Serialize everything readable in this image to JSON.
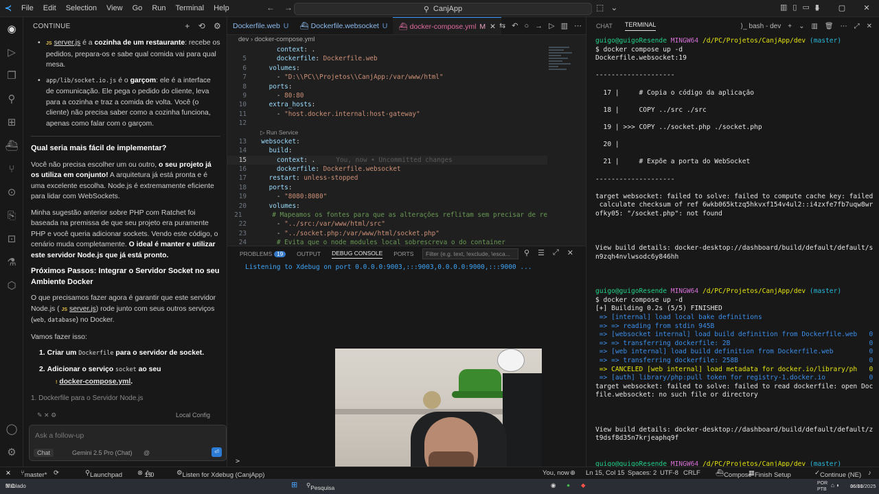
{
  "titlebar": {
    "menu": [
      "File",
      "Edit",
      "Selection",
      "View",
      "Go",
      "Run",
      "Terminal",
      "Help"
    ],
    "search_text": "CanjApp"
  },
  "sidepanel": {
    "header": "CONTINUE",
    "chat": {
      "b1_file": "server.js",
      "b1_js": "JS",
      "b1_mid": " é a ",
      "b1_bold": "cozinha de um restaurante",
      "b1_rest": ": recebe os pedidos, prepara-os e sabe qual comida vai para qual mesa.",
      "b2_code": "app/lib/socket.io.js",
      "b2_mid": " é o ",
      "b2_bold": "garçom",
      "b2_rest": ": ele é a interface de comunicação. Ele pega o pedido do cliente, leva para a cozinha e traz a comida de volta. Você (o cliente) não precisa saber como a cozinha funciona, apenas como falar com o garçom.",
      "h1": "Qual seria mais fácil de implementar?",
      "p1_a": "Você não precisa escolher um ou outro, ",
      "p1_bold": "o seu projeto já os utiliza em conjunto!",
      "p1_b": " A arquitetura já está pronta e é uma excelente escolha. Node.js é extremamente eficiente para lidar com WebSockets.",
      "p2_a": "Minha sugestão anterior sobre PHP com Ratchet foi baseada na premissa de que seu projeto era puramente PHP e você queria adicionar sockets. Vendo este código, o cenário muda completamente. ",
      "p2_bold": "O ideal é manter e utilizar este servidor Node.js que já está pronto.",
      "h2": "Próximos Passos: Integrar o Servidor Socket no seu Ambiente Docker",
      "p3_a": "O que precisamos fazer agora é garantir que este servidor Node.js (",
      "p3_js": "JS",
      "p3_file": "server.js",
      "p3_b": ") rode junto com seus outros serviços (",
      "p3_code1": "web",
      "p3_sep": ", ",
      "p3_code2": "database",
      "p3_c": ") no Docker.",
      "p4": "Vamos fazer isso:",
      "s1_num": "1.",
      "s1_a": "Criar um ",
      "s1_code": "Dockerfile",
      "s1_b": " para o servidor de socket.",
      "s2_num": "2.",
      "s2_a": "Adicionar o serviço ",
      "s2_code": "socket",
      "s2_b": " ao seu",
      "s2_file": "docker-compose.yml",
      "s2_end": ".",
      "s3_ghost": "1. Dockerfile para o Servidor Node.js"
    },
    "local_config": "Local Config",
    "input_placeholder": "Ask a follow-up",
    "chip": "Chat",
    "model": "Gemini 2.5 Pro (Chat)",
    "at": "@"
  },
  "editor": {
    "tabs": [
      {
        "label": "Dockerfile.web",
        "suffix": "U"
      },
      {
        "label": "Dockerfile.websocket",
        "suffix": "U"
      },
      {
        "label": "docker-compose.yml",
        "suffix": "M"
      }
    ],
    "breadcrumb": "dev  ›  docker-compose.yml",
    "codelens": "Run Service",
    "blame": "You, now • Uncommitted changes"
  },
  "panel": {
    "tabs": [
      "PROBLEMS",
      "OUTPUT",
      "DEBUG CONSOLE",
      "PORTS"
    ],
    "problems_count": "19",
    "filter_placeholder": "Filter (e.g. text, !exclude, \\esca...",
    "output_line": "Listening to Xdebug on port 0.0.0.0:9003,:::9003,0.0.0.0:9000,:::9000 ...",
    "prompt": ">"
  },
  "terminal": {
    "tab_chat": "CHAT",
    "tab_terminal": "TERMINAL",
    "shell": "bash - dev"
  },
  "status": {
    "branch": "master*",
    "launch": "Launchpad",
    "errors": "19",
    "warnings": "0",
    "xdebug": "Listen for Xdebug (CanjApp)",
    "blame": "You, now",
    "pos": "Ln 15, Col 15",
    "spaces": "Spaces: 2",
    "enc": "UTF-8",
    "eol": "CRLF",
    "compose": "Compose",
    "finish": "Finish Setup",
    "cont": "Continue (NE)"
  },
  "taskbar": {
    "weather": "9°C",
    "weather_sub": "Nublado",
    "search": "Pesquisa",
    "lang": "POR\nPTB",
    "time": "16:10",
    "date": "06/01/2025"
  }
}
